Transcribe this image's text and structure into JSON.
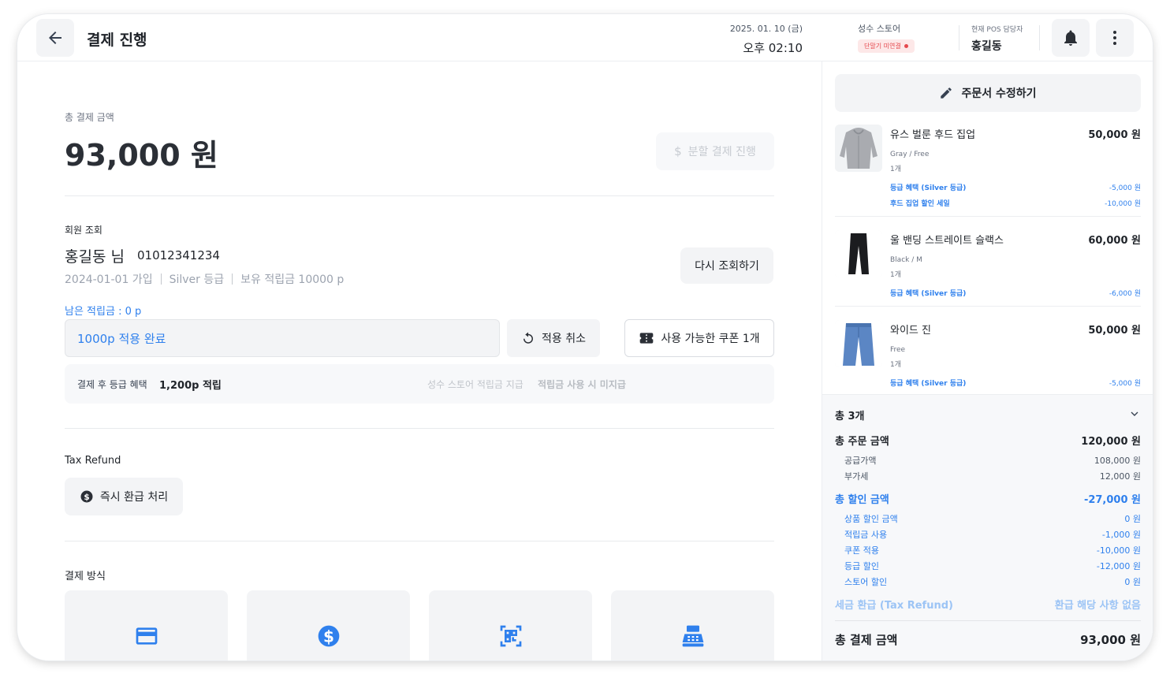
{
  "header": {
    "title": "결제 진행",
    "date": "2025. 01. 10 (금)",
    "time": "오후 02:10",
    "store_name": "성수 스토어",
    "store_status": "단말기 미연결",
    "staff_label": "현재 POS 담당자",
    "staff_name": "홍길동"
  },
  "payment": {
    "total_label": "총 결제 금액",
    "total_amount": "93,000 원",
    "split_button": "분할 결제 진행"
  },
  "member": {
    "section_label": "회원 조회",
    "name": "홍길동 님",
    "phone": "01012341234",
    "joined": "2024-01-01 가입",
    "grade": "Silver 등급",
    "points_held": "보유 적립금 10000 p",
    "relookup_button": "다시 조회하기",
    "remaining_points": "남은 적립금 : 0 p",
    "point_input_value": "1000p 적용 완료",
    "cancel_button": "적용 취소",
    "coupon_button": "사용 가능한 쿠폰 1개",
    "benefit_label": "결제 후 등급 혜택",
    "benefit_value": "1,200p 적립",
    "store_point_label": "성수 스토어 적립금 지급",
    "store_point_value": "적립금 사용 시 미지급"
  },
  "tax_refund": {
    "label": "Tax Refund",
    "button": "즉시 환급 처리"
  },
  "payment_methods": {
    "label": "결제 방식",
    "methods": [
      {
        "icon": "credit-card-icon"
      },
      {
        "icon": "dollar-circle-icon"
      },
      {
        "icon": "qr-code-icon"
      },
      {
        "icon": "cash-register-icon"
      }
    ]
  },
  "order": {
    "edit_button": "주문서 수정하기",
    "items": [
      {
        "name": "유스 벌룬 후드 집업",
        "price": "50,000 원",
        "option": "Gray / Free",
        "qty": "1개",
        "discounts": [
          {
            "label": "등급 혜택 (Silver 등급)",
            "value": "-5,000 원"
          },
          {
            "label": "후드 집업 할인 세일",
            "value": "-10,000 원"
          }
        ]
      },
      {
        "name": "울 밴딩 스트레이트 슬랙스",
        "price": "60,000 원",
        "option": "Black / M",
        "qty": "1개",
        "discounts": [
          {
            "label": "등급 혜택 (Silver 등급)",
            "value": "-6,000 원"
          }
        ]
      },
      {
        "name": "와이드 진",
        "price": "50,000 원",
        "option": "Free",
        "qty": "1개",
        "discounts": [
          {
            "label": "등급 혜택 (Silver 등급)",
            "value": "-5,000 원"
          }
        ]
      }
    ]
  },
  "summary": {
    "count": "총 3개",
    "order_total_label": "총 주문 금액",
    "order_total": "120,000 원",
    "supply_label": "공급가액",
    "supply": "108,000 원",
    "vat_label": "부가세",
    "vat": "12,000 원",
    "discount_total_label": "총 할인 금액",
    "discount_total": "-27,000 원",
    "discount_rows": [
      {
        "label": "상품 할인 금액",
        "value": "0 원"
      },
      {
        "label": "적립금 사용",
        "value": "-1,000 원"
      },
      {
        "label": "쿠폰 적용",
        "value": "-10,000 원"
      },
      {
        "label": "등급 할인",
        "value": "-12,000 원"
      },
      {
        "label": "스토어 할인",
        "value": "0 원"
      }
    ],
    "tax_refund_label": "세금 환급 (Tax Refund)",
    "tax_refund_value": "환급 해당 사항 없음",
    "final_label": "총 결제 금액",
    "final_total": "93,000 원"
  },
  "colors": {
    "accent": "#2f80ed",
    "danger": "#e5484d",
    "surface": "#f3f4f6"
  }
}
